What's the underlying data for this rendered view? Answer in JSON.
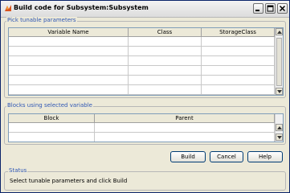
{
  "window": {
    "title": "Build code for Subsystem:Subsystem",
    "icon": "matlab-icon"
  },
  "tunable": {
    "label": "Pick tunable parameters",
    "columns": [
      "Variable Name",
      "Class",
      "StorageClass"
    ],
    "rows": [
      [
        "",
        "",
        ""
      ],
      [
        "",
        "",
        ""
      ],
      [
        "",
        "",
        ""
      ],
      [
        "",
        "",
        ""
      ],
      [
        "",
        "",
        ""
      ],
      [
        "",
        "",
        ""
      ]
    ]
  },
  "blocks": {
    "label": "Blocks using selected variable",
    "columns": [
      "Block",
      "Parent"
    ],
    "rows": [
      [
        "",
        ""
      ],
      [
        "",
        ""
      ]
    ]
  },
  "buttons": {
    "build": "Build",
    "cancel": "Cancel",
    "help": "Help"
  },
  "status": {
    "label": "Status",
    "text": "Select tunable parameters and click Build"
  }
}
